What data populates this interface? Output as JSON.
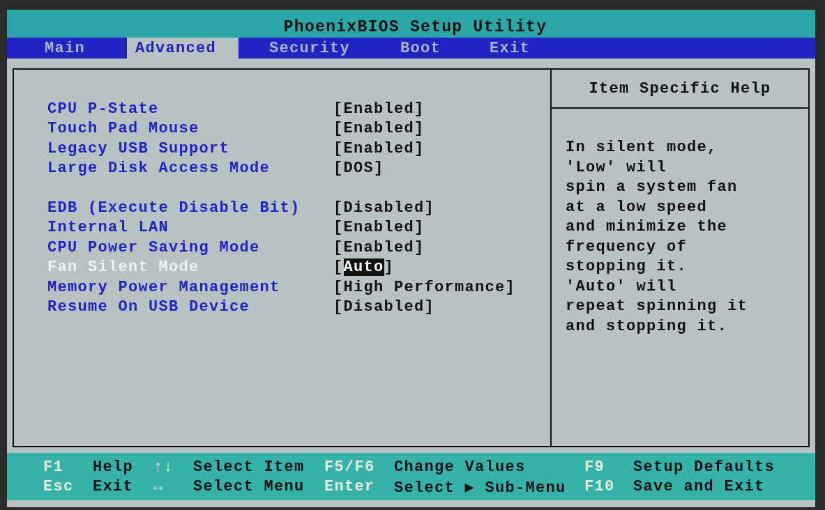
{
  "title": "PhoenixBIOS Setup Utility",
  "tabs": [
    {
      "label": "Main",
      "selected": false
    },
    {
      "label": "Advanced",
      "selected": true
    },
    {
      "label": "Security",
      "selected": false
    },
    {
      "label": "Boot",
      "selected": false
    },
    {
      "label": "Exit",
      "selected": false
    }
  ],
  "setting_groups": [
    {
      "items": [
        {
          "label": "CPU P-State",
          "value": "[Enabled]",
          "selected": false
        },
        {
          "label": "Touch Pad Mouse",
          "value": "[Enabled]",
          "selected": false
        },
        {
          "label": "Legacy USB Support",
          "value": "[Enabled]",
          "selected": false
        },
        {
          "label": "Large Disk Access Mode",
          "value": "[DOS]",
          "selected": false
        }
      ]
    },
    {
      "items": [
        {
          "label": "EDB (Execute Disable Bit)",
          "value": "[Disabled]",
          "selected": false
        },
        {
          "label": "Internal LAN",
          "value": "[Enabled]",
          "selected": false
        },
        {
          "label": "CPU Power Saving Mode",
          "value": "[Enabled]",
          "selected": false
        },
        {
          "label": "Fan Silent Mode",
          "value": "[Auto]",
          "selected": true
        },
        {
          "label": "Memory Power Management",
          "value": "[High Performance]",
          "selected": false
        },
        {
          "label": "Resume On USB Device",
          "value": "[Disabled]",
          "selected": false
        }
      ]
    }
  ],
  "help": {
    "title": "Item Specific Help",
    "text": "In silent mode,\n'Low' will\nspin a system fan\nat a low speed\nand minimize the\nfrequency of\nstopping it.\n'Auto' will\nrepeat spinning it\nand stopping it."
  },
  "key_legend": [
    {
      "key": "F1",
      "action": "Help"
    },
    {
      "key": "↑↓",
      "action": "Select Item"
    },
    {
      "key": "F5/F6",
      "action": "Change Values"
    },
    {
      "key": "F9",
      "action": "Setup Defaults"
    },
    {
      "key": "Esc",
      "action": "Exit"
    },
    {
      "key": "↔",
      "action": "Select Menu"
    },
    {
      "key": "Enter",
      "action": "Select ▶ Sub-Menu"
    },
    {
      "key": "F10",
      "action": "Save and Exit"
    }
  ]
}
